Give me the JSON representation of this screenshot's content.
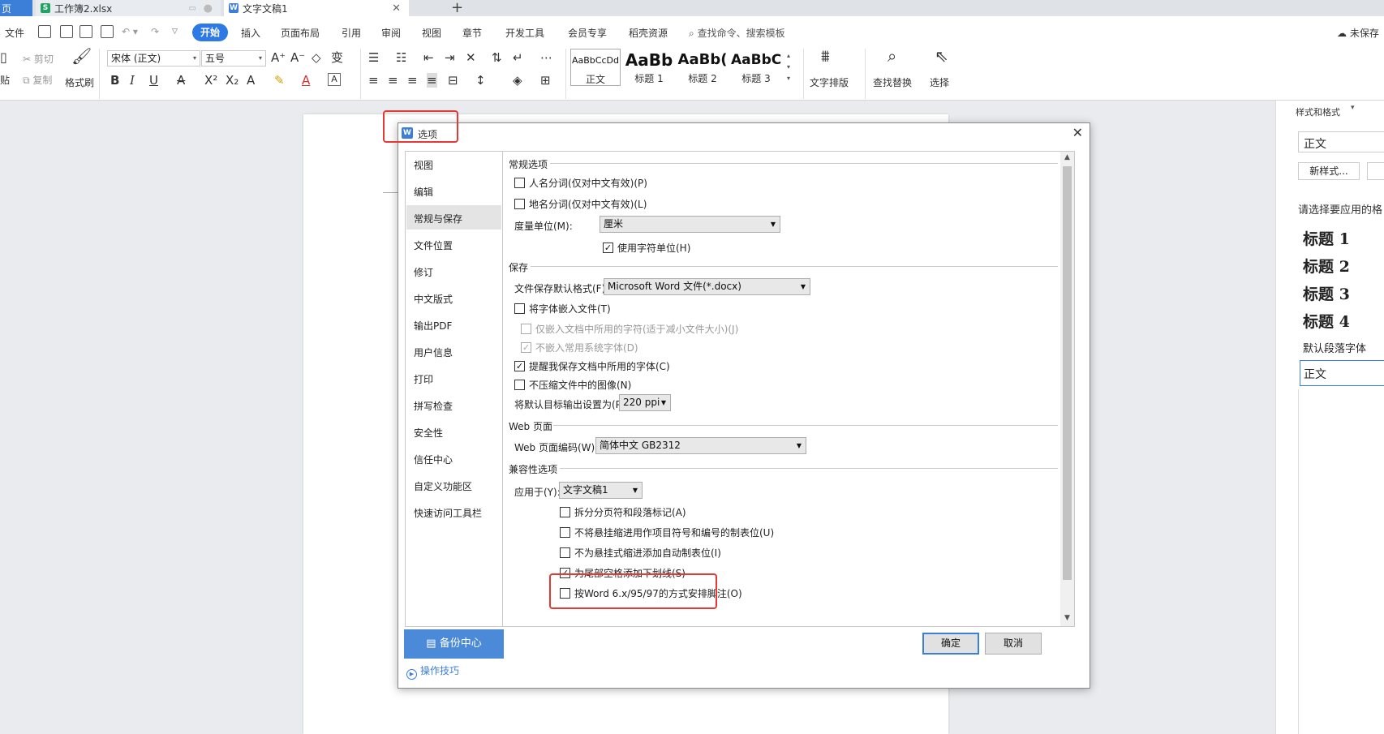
{
  "tabs": [
    {
      "label": "页"
    },
    {
      "label": "工作簿2.xlsx",
      "icon": "S"
    },
    {
      "label": "文字文稿1",
      "icon": "W"
    }
  ],
  "menu": {
    "file": "文件",
    "items": [
      "开始",
      "插入",
      "页面布局",
      "引用",
      "审阅",
      "视图",
      "章节",
      "开发工具",
      "会员专享",
      "稻壳资源"
    ],
    "search": "查找命令、搜索模板",
    "unsaved": "未保存"
  },
  "ribbon": {
    "cut": "剪切",
    "copy": "复制",
    "paste": "贴",
    "format_painter": "格式刷",
    "font_name": "宋体 (正文)",
    "font_size": "五号",
    "styles": [
      {
        "preview": "AaBbCcDd",
        "name": "正文"
      },
      {
        "preview": "AaBb",
        "name": "标题 1"
      },
      {
        "preview": "AaBb(",
        "name": "标题 2"
      },
      {
        "preview": "AaBbC",
        "name": "标题 3"
      }
    ],
    "text_layout": "文字排版",
    "find_replace": "查找替换",
    "select": "选择"
  },
  "right_panel": {
    "title": "样式和格式",
    "current_style": "正文",
    "new_style": "新样式...",
    "prompt": "请选择要应用的格",
    "styles": [
      "标题 1",
      "标题 2",
      "标题 3",
      "标题 4"
    ],
    "default_font": "默认段落字体",
    "body": "正文"
  },
  "dialog": {
    "title": "选项",
    "nav": [
      "视图",
      "编辑",
      "常规与保存",
      "文件位置",
      "修订",
      "中文版式",
      "输出PDF",
      "用户信息",
      "打印",
      "拼写检查",
      "安全性",
      "信任中心",
      "自定义功能区",
      "快速访问工具栏"
    ],
    "selected_nav": "常规与保存",
    "backup": "备份中心",
    "tips": "操作技巧",
    "general": {
      "title": "常规选项",
      "opt1": "人名分词(仅对中文有效)(P)",
      "opt2": "地名分词(仅对中文有效)(L)",
      "unit_label": "度量单位(M):",
      "unit_value": "厘米",
      "char_unit": "使用字符单位(H)"
    },
    "save": {
      "title": "保存",
      "format_label": "文件保存默认格式(F):",
      "format_value": "Microsoft Word 文件(*.docx)",
      "embed": "将字体嵌入文件(T)",
      "embed_used": "仅嵌入文档中所用的字符(适于减小文件大小)(J)",
      "no_common": "不嵌入常用系统字体(D)",
      "remind": "提醒我保存文档中所用的字体(C)",
      "no_compress": "不压缩文件中的图像(N)",
      "ppi_label": "将默认目标输出设置为(P):",
      "ppi_value": "220 ppi"
    },
    "web": {
      "title": "Web 页面",
      "encoding_label": "Web 页面编码(W):",
      "encoding_value": "简体中文 GB2312"
    },
    "compat": {
      "title": "兼容性选项",
      "apply_label": "应用于(Y):",
      "apply_value": "文字文稿1",
      "o1": "拆分分页符和段落标记(A)",
      "o2": "不将悬挂缩进用作项目符号和编号的制表位(U)",
      "o3": "不为悬挂式缩进添加自动制表位(I)",
      "o4": "为尾部空格添加下划线(S)",
      "o5": "按Word 6.x/95/97的方式安排脚注(O)"
    },
    "ok": "确定",
    "cancel": "取消"
  },
  "colors": {
    "accent": "#2d7ae6",
    "highlight": "#e53935"
  }
}
